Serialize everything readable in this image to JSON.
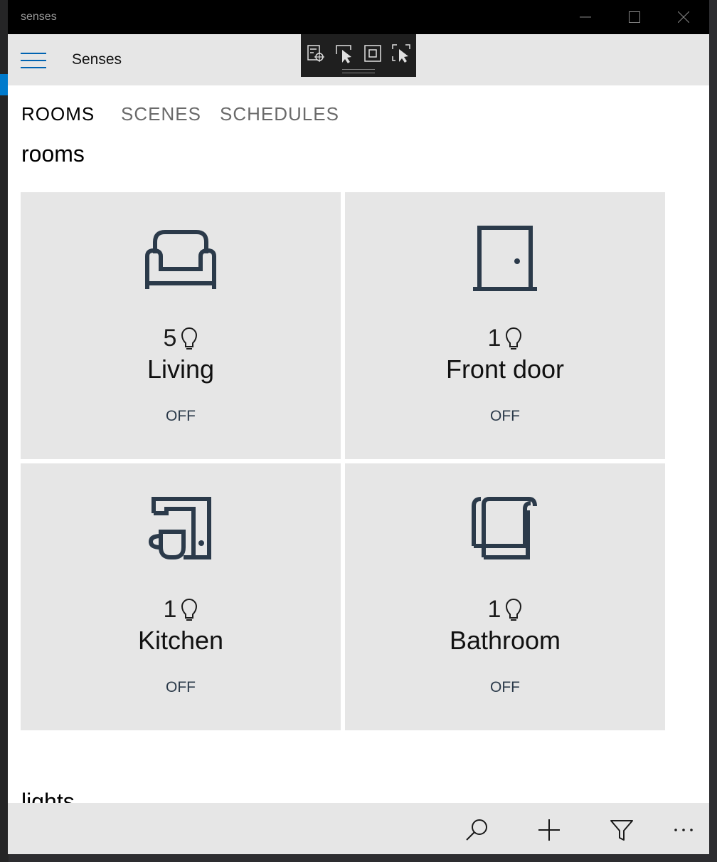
{
  "window": {
    "title": "senses"
  },
  "app": {
    "title": "Senses"
  },
  "tabs": [
    {
      "label": "ROOMS",
      "active": true
    },
    {
      "label": "SCENES",
      "active": false
    },
    {
      "label": "SCHEDULES",
      "active": false
    }
  ],
  "sections": {
    "rooms_heading": "rooms",
    "next_heading": "lights"
  },
  "rooms": [
    {
      "name": "Living",
      "lights": "5",
      "state": "OFF",
      "icon": "sofa-icon"
    },
    {
      "name": "Front door",
      "lights": "1",
      "state": "OFF",
      "icon": "door-icon"
    },
    {
      "name": "Kitchen",
      "lights": "1",
      "state": "OFF",
      "icon": "kitchen-coffee-icon"
    },
    {
      "name": "Bathroom",
      "lights": "1",
      "state": "OFF",
      "icon": "towel-icon"
    }
  ],
  "commands": [
    "search-icon",
    "add-icon",
    "filter-icon",
    "more-icon"
  ],
  "colors": {
    "accent": "#0063b1",
    "tile": "#e6e6e6",
    "icon": "#2b3a4a",
    "appbar": "#e6e6e6"
  }
}
